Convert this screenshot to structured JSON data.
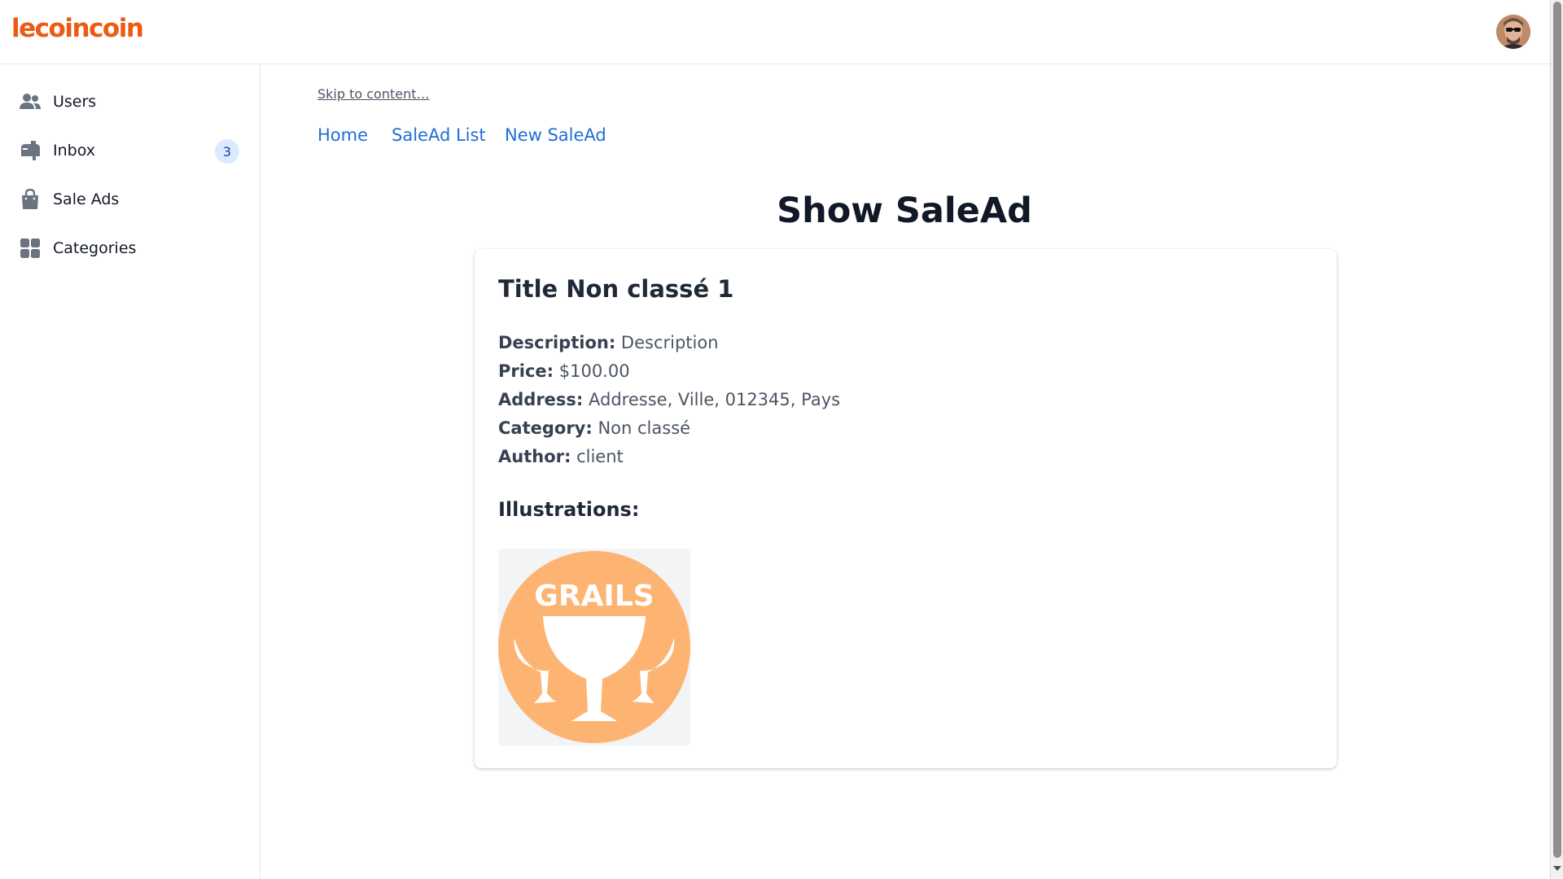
{
  "header": {
    "logo_text": "lecoincoin",
    "brand_color": "#ec5a13"
  },
  "sidebar": {
    "items": [
      {
        "label": "Users",
        "icon": "users-icon"
      },
      {
        "label": "Inbox",
        "icon": "mailbox-icon",
        "badge": "3"
      },
      {
        "label": "Sale Ads",
        "icon": "shopping-bag-icon"
      },
      {
        "label": "Categories",
        "icon": "grid-icon"
      }
    ]
  },
  "main": {
    "skip_link": "Skip to content…",
    "nav": [
      {
        "label": "Home"
      },
      {
        "label": "SaleAd List"
      },
      {
        "label": "New SaleAd"
      }
    ],
    "title": "Show SaleAd",
    "card": {
      "title": "Title Non classé 1",
      "fields": [
        {
          "key": "Description:",
          "value": "Description"
        },
        {
          "key": "Price:",
          "value": "$100.00"
        },
        {
          "key": "Address:",
          "value": "Addresse, Ville, 012345, Pays"
        },
        {
          "key": "Category:",
          "value": "Non classé"
        },
        {
          "key": "Author:",
          "value": "client"
        }
      ],
      "illustrations_label": "Illustrations:",
      "illustration_logo_text": "GRAILS",
      "illustration_color": "#fdb472"
    },
    "link_color": "#1f6fd4"
  }
}
